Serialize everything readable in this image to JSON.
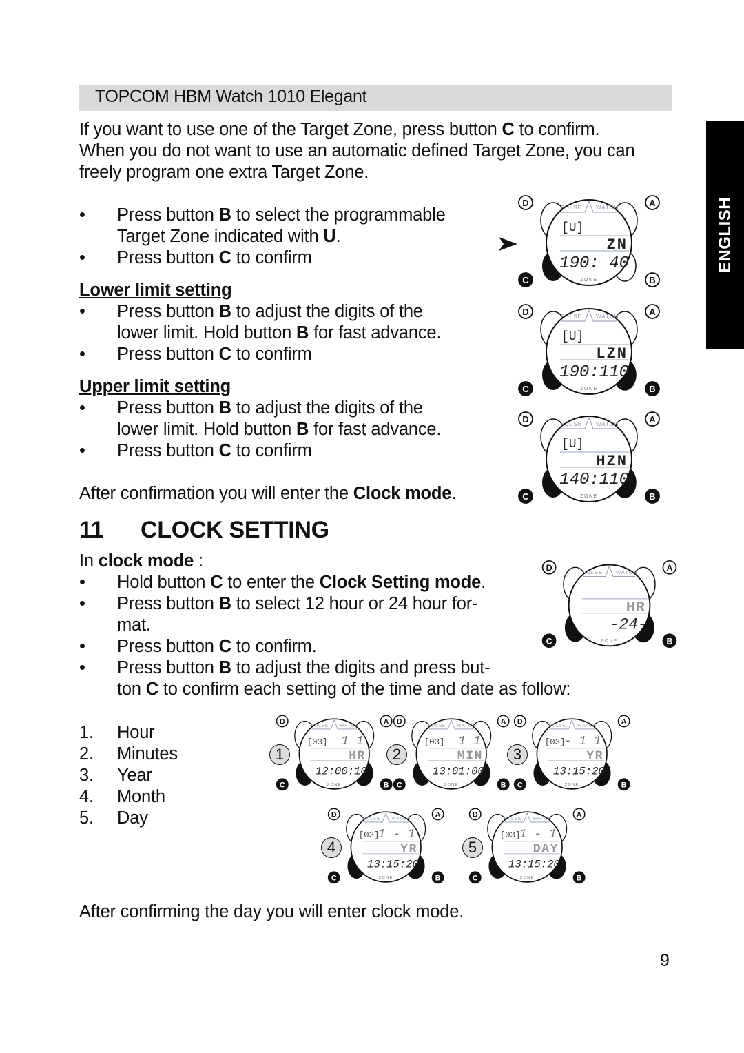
{
  "header": {
    "title": "TOPCOM HBM Watch 1010 Elegant"
  },
  "language_tab": "ENGLISH",
  "intro": {
    "line1_a": "If you want to use one of the Target Zone, press button ",
    "line1_b": "C",
    "line1_c": " to confirm.",
    "line2": "When you do not want to use an automatic defined Target Zone, you can",
    "line3": "freely program one extra Target Zone."
  },
  "program_zone": {
    "bullets": [
      {
        "a": "Press button ",
        "b": "B",
        "c": " to select the programmable",
        "d": "Target Zone indicated with ",
        "e": "U",
        "f": "."
      },
      {
        "a": "Press button ",
        "b": "C",
        "c": " to confirm"
      }
    ]
  },
  "lower_limit": {
    "title": "Lower limit setting",
    "bullets": [
      {
        "a": "Press button ",
        "b": "B",
        "c": " to adjust the digits of the",
        "d": "lower limit. Hold button ",
        "e": "B",
        "f": " for fast advance."
      },
      {
        "a": "Press button ",
        "b": "C",
        "c": " to confirm"
      }
    ]
  },
  "upper_limit": {
    "title": "Upper limit setting",
    "bullets": [
      {
        "a": "Press button ",
        "b": "B",
        "c": " to adjust the digits of the",
        "d": "lower limit. Hold button ",
        "e": "B",
        "f": " for fast advance."
      },
      {
        "a": "Press button ",
        "b": "C",
        "c": " to confirm"
      }
    ]
  },
  "after_confirm": {
    "a": "After confirmation you will enter the ",
    "b": "Clock mode",
    "c": "."
  },
  "section": {
    "number": "11",
    "title": "CLOCK SETTING"
  },
  "clock_mode": {
    "intro_a": "In ",
    "intro_b": "clock mode",
    "intro_c": " :",
    "bullets": [
      {
        "a": "Hold button ",
        "b": "C",
        "c": " to enter the ",
        "d": "Clock Setting mode",
        "e": "."
      },
      {
        "a": "Press button ",
        "b": "B",
        "c": " to select 12 hour or 24 hour for-",
        "d": "mat."
      },
      {
        "a": "Press button ",
        "b": "C",
        "c": " to confirm."
      },
      {
        "a": "Press button ",
        "b": "B",
        "c": " to adjust the digits and press but-",
        "d": "ton ",
        "e": "C",
        "f": " to confirm each setting of the time and date as follow:"
      }
    ]
  },
  "steps": [
    {
      "num": "1.",
      "label": "Hour"
    },
    {
      "num": "2.",
      "label": "Minutes"
    },
    {
      "num": "3.",
      "label": "Year"
    },
    {
      "num": "4.",
      "label": "Month"
    },
    {
      "num": "5.",
      "label": "Day"
    }
  ],
  "footer_text": "After confirming the day you will enter clock mode.",
  "page_number": "9",
  "watches": {
    "buttons": {
      "a": "A",
      "b": "B",
      "c": "C",
      "d": "D"
    },
    "brand_left": "PULSE",
    "brand_right": "WATCH",
    "zone_label": "ZONE",
    "zone_select": {
      "indicator": "U",
      "mode": "ZN",
      "value": "190: 40"
    },
    "lower_limit": {
      "indicator": "U",
      "mode": "LZN",
      "value": "190:110"
    },
    "upper_limit": {
      "indicator": "U",
      "mode": "HZN",
      "value": "140:110"
    },
    "hour_format": {
      "mode": "HR",
      "value": "-24-"
    },
    "step_hour": {
      "step": "1",
      "date": "03",
      "top": "1  1",
      "mode": "HR",
      "value": "12:00:10"
    },
    "step_minutes": {
      "step": "2",
      "date": "03",
      "top": "1  1",
      "mode": "MIN",
      "value": "13:01:00"
    },
    "step_year": {
      "step": "3",
      "date": "03",
      "top": "- 1  1",
      "mode": "YR",
      "value": "13:15:20"
    },
    "step_month": {
      "step": "4",
      "date": "03",
      "top": "1 - 1",
      "mode": "YR",
      "value": "13:15:20"
    },
    "step_day": {
      "step": "5",
      "date": "03",
      "top": "1 - 1",
      "mode": "DAY",
      "value": "13:15:20"
    }
  }
}
